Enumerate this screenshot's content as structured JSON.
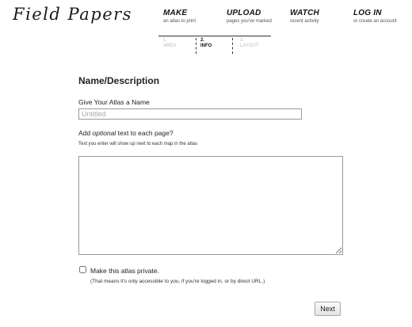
{
  "app": {
    "logo_text": "Field Papers"
  },
  "nav": [
    {
      "title": "MAKE",
      "subtitle": "an atlas to print"
    },
    {
      "title": "UPLOAD",
      "subtitle": "pages you've marked"
    },
    {
      "title": "WATCH",
      "subtitle": "recent activity"
    },
    {
      "title": "LOG IN",
      "subtitle": "or create an account"
    }
  ],
  "steps": [
    {
      "number": "1.",
      "label": "AREA",
      "state": "inactive"
    },
    {
      "number": "2.",
      "label": "INFO",
      "state": "active"
    },
    {
      "number": "3.",
      "label": "LAYOUT",
      "state": "inactive"
    }
  ],
  "form": {
    "heading": "Name/Description",
    "name_label": "Give Your Atlas a Name",
    "name_value": "",
    "name_placeholder": "Untitled",
    "text_prompt_before": "Add ",
    "text_prompt_emphasis": "optional",
    "text_prompt_after": " text to each page?",
    "text_help": "Text you enter will show up next to each map in the atlas",
    "page_text_value": "",
    "private_label": "Make this atlas private.",
    "private_checked": false,
    "private_note": "(That means it's only accessible to you, if you're logged in, or by direct URL.)",
    "next_label": "Next"
  },
  "colors": {
    "text": "#222222",
    "inactive_step": "#bbbbbb",
    "border": "#999999"
  }
}
